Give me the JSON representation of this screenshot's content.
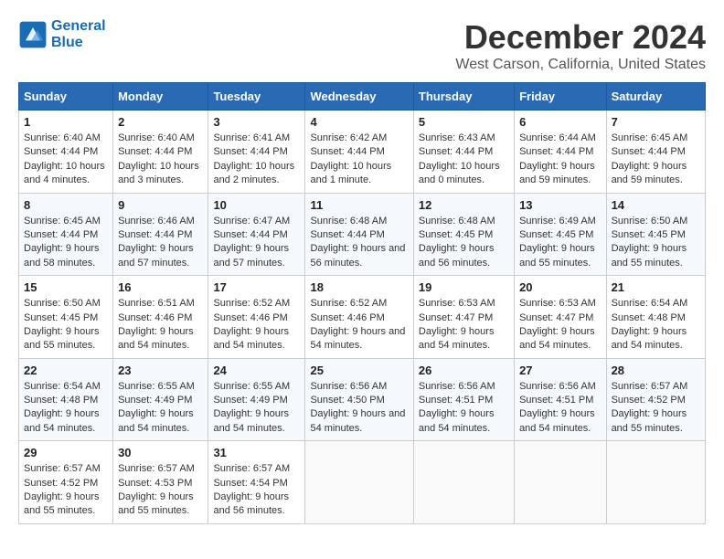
{
  "header": {
    "logo_line1": "General",
    "logo_line2": "Blue",
    "month_title": "December 2024",
    "location": "West Carson, California, United States"
  },
  "days_of_week": [
    "Sunday",
    "Monday",
    "Tuesday",
    "Wednesday",
    "Thursday",
    "Friday",
    "Saturday"
  ],
  "weeks": [
    [
      {
        "day": "1",
        "sunrise": "6:40 AM",
        "sunset": "4:44 PM",
        "daylight": "10 hours and 4 minutes."
      },
      {
        "day": "2",
        "sunrise": "6:40 AM",
        "sunset": "4:44 PM",
        "daylight": "10 hours and 3 minutes."
      },
      {
        "day": "3",
        "sunrise": "6:41 AM",
        "sunset": "4:44 PM",
        "daylight": "10 hours and 2 minutes."
      },
      {
        "day": "4",
        "sunrise": "6:42 AM",
        "sunset": "4:44 PM",
        "daylight": "10 hours and 1 minute."
      },
      {
        "day": "5",
        "sunrise": "6:43 AM",
        "sunset": "4:44 PM",
        "daylight": "10 hours and 0 minutes."
      },
      {
        "day": "6",
        "sunrise": "6:44 AM",
        "sunset": "4:44 PM",
        "daylight": "9 hours and 59 minutes."
      },
      {
        "day": "7",
        "sunrise": "6:45 AM",
        "sunset": "4:44 PM",
        "daylight": "9 hours and 59 minutes."
      }
    ],
    [
      {
        "day": "8",
        "sunrise": "6:45 AM",
        "sunset": "4:44 PM",
        "daylight": "9 hours and 58 minutes."
      },
      {
        "day": "9",
        "sunrise": "6:46 AM",
        "sunset": "4:44 PM",
        "daylight": "9 hours and 57 minutes."
      },
      {
        "day": "10",
        "sunrise": "6:47 AM",
        "sunset": "4:44 PM",
        "daylight": "9 hours and 57 minutes."
      },
      {
        "day": "11",
        "sunrise": "6:48 AM",
        "sunset": "4:44 PM",
        "daylight": "9 hours and 56 minutes."
      },
      {
        "day": "12",
        "sunrise": "6:48 AM",
        "sunset": "4:45 PM",
        "daylight": "9 hours and 56 minutes."
      },
      {
        "day": "13",
        "sunrise": "6:49 AM",
        "sunset": "4:45 PM",
        "daylight": "9 hours and 55 minutes."
      },
      {
        "day": "14",
        "sunrise": "6:50 AM",
        "sunset": "4:45 PM",
        "daylight": "9 hours and 55 minutes."
      }
    ],
    [
      {
        "day": "15",
        "sunrise": "6:50 AM",
        "sunset": "4:45 PM",
        "daylight": "9 hours and 55 minutes."
      },
      {
        "day": "16",
        "sunrise": "6:51 AM",
        "sunset": "4:46 PM",
        "daylight": "9 hours and 54 minutes."
      },
      {
        "day": "17",
        "sunrise": "6:52 AM",
        "sunset": "4:46 PM",
        "daylight": "9 hours and 54 minutes."
      },
      {
        "day": "18",
        "sunrise": "6:52 AM",
        "sunset": "4:46 PM",
        "daylight": "9 hours and 54 minutes."
      },
      {
        "day": "19",
        "sunrise": "6:53 AM",
        "sunset": "4:47 PM",
        "daylight": "9 hours and 54 minutes."
      },
      {
        "day": "20",
        "sunrise": "6:53 AM",
        "sunset": "4:47 PM",
        "daylight": "9 hours and 54 minutes."
      },
      {
        "day": "21",
        "sunrise": "6:54 AM",
        "sunset": "4:48 PM",
        "daylight": "9 hours and 54 minutes."
      }
    ],
    [
      {
        "day": "22",
        "sunrise": "6:54 AM",
        "sunset": "4:48 PM",
        "daylight": "9 hours and 54 minutes."
      },
      {
        "day": "23",
        "sunrise": "6:55 AM",
        "sunset": "4:49 PM",
        "daylight": "9 hours and 54 minutes."
      },
      {
        "day": "24",
        "sunrise": "6:55 AM",
        "sunset": "4:49 PM",
        "daylight": "9 hours and 54 minutes."
      },
      {
        "day": "25",
        "sunrise": "6:56 AM",
        "sunset": "4:50 PM",
        "daylight": "9 hours and 54 minutes."
      },
      {
        "day": "26",
        "sunrise": "6:56 AM",
        "sunset": "4:51 PM",
        "daylight": "9 hours and 54 minutes."
      },
      {
        "day": "27",
        "sunrise": "6:56 AM",
        "sunset": "4:51 PM",
        "daylight": "9 hours and 54 minutes."
      },
      {
        "day": "28",
        "sunrise": "6:57 AM",
        "sunset": "4:52 PM",
        "daylight": "9 hours and 55 minutes."
      }
    ],
    [
      {
        "day": "29",
        "sunrise": "6:57 AM",
        "sunset": "4:52 PM",
        "daylight": "9 hours and 55 minutes."
      },
      {
        "day": "30",
        "sunrise": "6:57 AM",
        "sunset": "4:53 PM",
        "daylight": "9 hours and 55 minutes."
      },
      {
        "day": "31",
        "sunrise": "6:57 AM",
        "sunset": "4:54 PM",
        "daylight": "9 hours and 56 minutes."
      },
      null,
      null,
      null,
      null
    ]
  ]
}
